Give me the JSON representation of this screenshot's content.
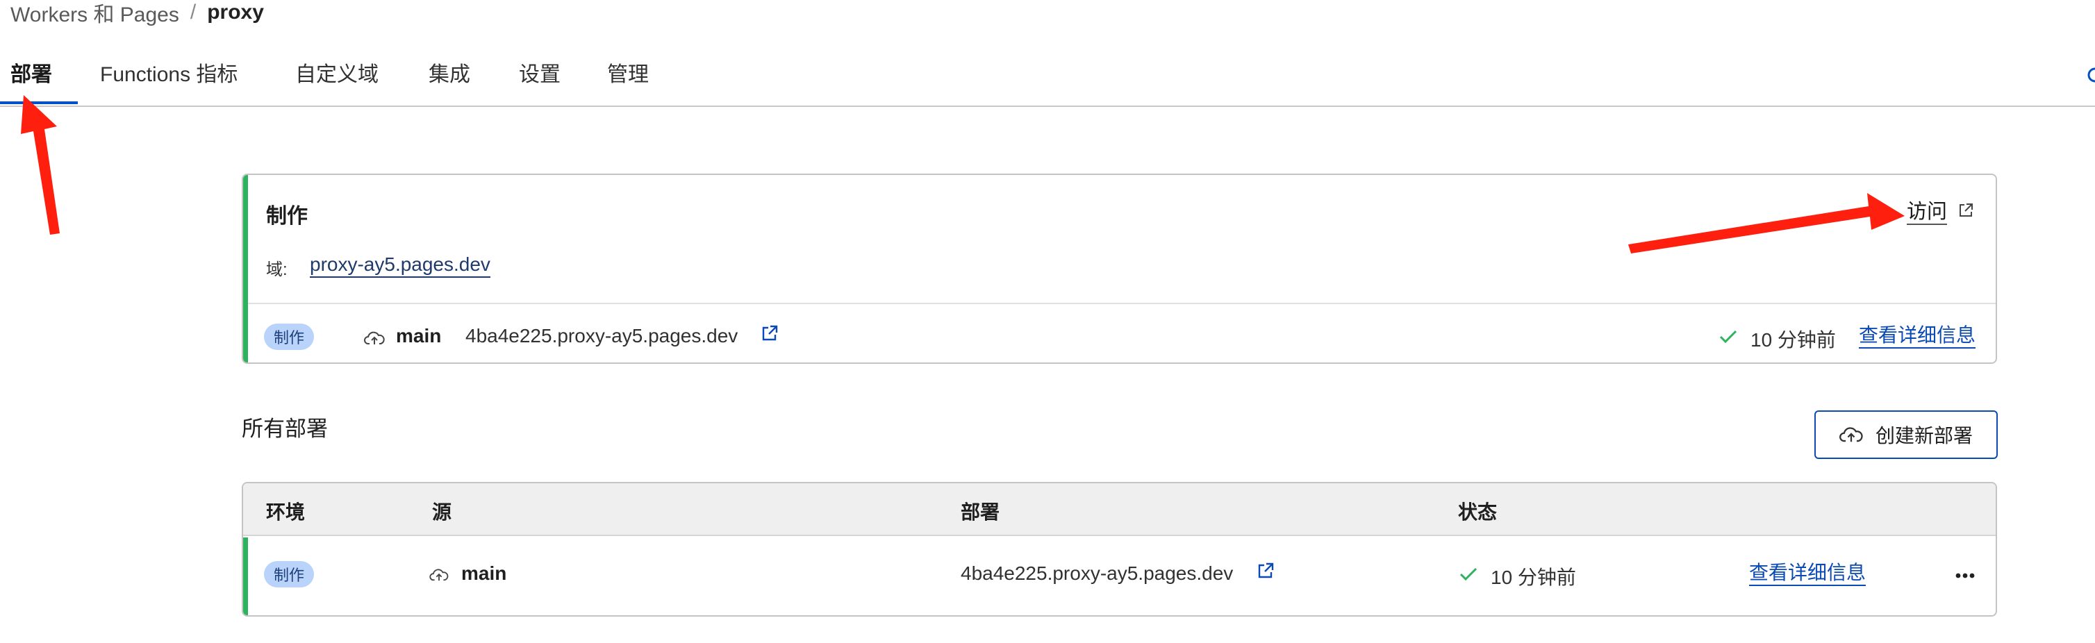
{
  "breadcrumb": {
    "parent": "Workers 和 Pages",
    "separator": "/",
    "current": "proxy"
  },
  "tabs": [
    {
      "label": "部署",
      "active": true
    },
    {
      "label": "Functions 指标",
      "active": false
    },
    {
      "label": "自定义域",
      "active": false
    },
    {
      "label": "集成",
      "active": false
    },
    {
      "label": "设置",
      "active": false
    },
    {
      "label": "管理",
      "active": false
    }
  ],
  "production": {
    "title": "制作",
    "domain_label": "域:",
    "domain": "proxy-ay5.pages.dev",
    "visit_label": "访问",
    "deployment": {
      "environment": "制作",
      "branch": "main",
      "url": "4ba4e225.proxy-ay5.pages.dev",
      "status": "10 分钟前",
      "details_label": "查看详细信息"
    }
  },
  "all_deployments": {
    "title": "所有部署",
    "create_button": "创建新部署",
    "columns": [
      "环境",
      "源",
      "部署",
      "状态"
    ],
    "rows": [
      {
        "environment": "制作",
        "source": "main",
        "deployment": "4ba4e225.proxy-ay5.pages.dev",
        "status": "10 分钟前",
        "details_label": "查看详细信息"
      }
    ]
  },
  "colors": {
    "accent_blue": "#0051c3",
    "success_green": "#2db35d",
    "badge_bg": "#b9d3fb",
    "annotation_red": "#ff1f0f"
  },
  "icons": [
    "cloud-upload-icon",
    "external-link-icon",
    "check-icon",
    "more-icon",
    "annotation-arrow"
  ]
}
